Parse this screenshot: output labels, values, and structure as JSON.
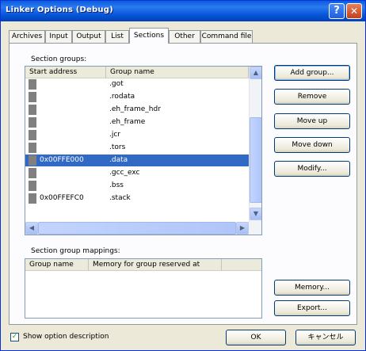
{
  "window": {
    "title": "Linker Options (Debug)",
    "help_glyph": "?",
    "close_glyph": "✕"
  },
  "tabs": [
    {
      "label": "Archives",
      "active": false
    },
    {
      "label": "Input",
      "active": false
    },
    {
      "label": "Output",
      "active": false
    },
    {
      "label": "List",
      "active": false
    },
    {
      "label": "Sections",
      "active": true
    },
    {
      "label": "Other",
      "active": false
    },
    {
      "label": "Command file",
      "active": false
    }
  ],
  "section_groups": {
    "label": "Section groups:",
    "columns": [
      "Start address",
      "Group name"
    ],
    "rows": [
      {
        "address": "",
        "name": ".got",
        "selected": false
      },
      {
        "address": "",
        "name": ".rodata",
        "selected": false
      },
      {
        "address": "",
        "name": ".eh_frame_hdr",
        "selected": false
      },
      {
        "address": "",
        "name": ".eh_frame",
        "selected": false
      },
      {
        "address": "",
        "name": ".jcr",
        "selected": false
      },
      {
        "address": "",
        "name": ".tors",
        "selected": false
      },
      {
        "address": "0x00FFE000",
        "name": ".data",
        "selected": true
      },
      {
        "address": "",
        "name": ".gcc_exc",
        "selected": false
      },
      {
        "address": "",
        "name": ".bss",
        "selected": false
      },
      {
        "address": "0x00FFEFC0",
        "name": ".stack",
        "selected": false
      }
    ]
  },
  "buttons": {
    "add_group": "Add group...",
    "remove": "Remove",
    "move_up": "Move up",
    "move_down": "Move down",
    "modify": "Modify...",
    "memory": "Memory...",
    "export": "Export...",
    "ok": "OK",
    "cancel": "キャンセル"
  },
  "section_group_mappings": {
    "label": "Section group mappings:",
    "columns": [
      "Group name",
      "Memory for group reserved at"
    ]
  },
  "show_option_description": {
    "label": "Show option description",
    "checked": true
  },
  "colors": {
    "titlebar": "#0a5ce0",
    "selection": "#316ac5",
    "dialog_bg": "#ece9d8"
  }
}
